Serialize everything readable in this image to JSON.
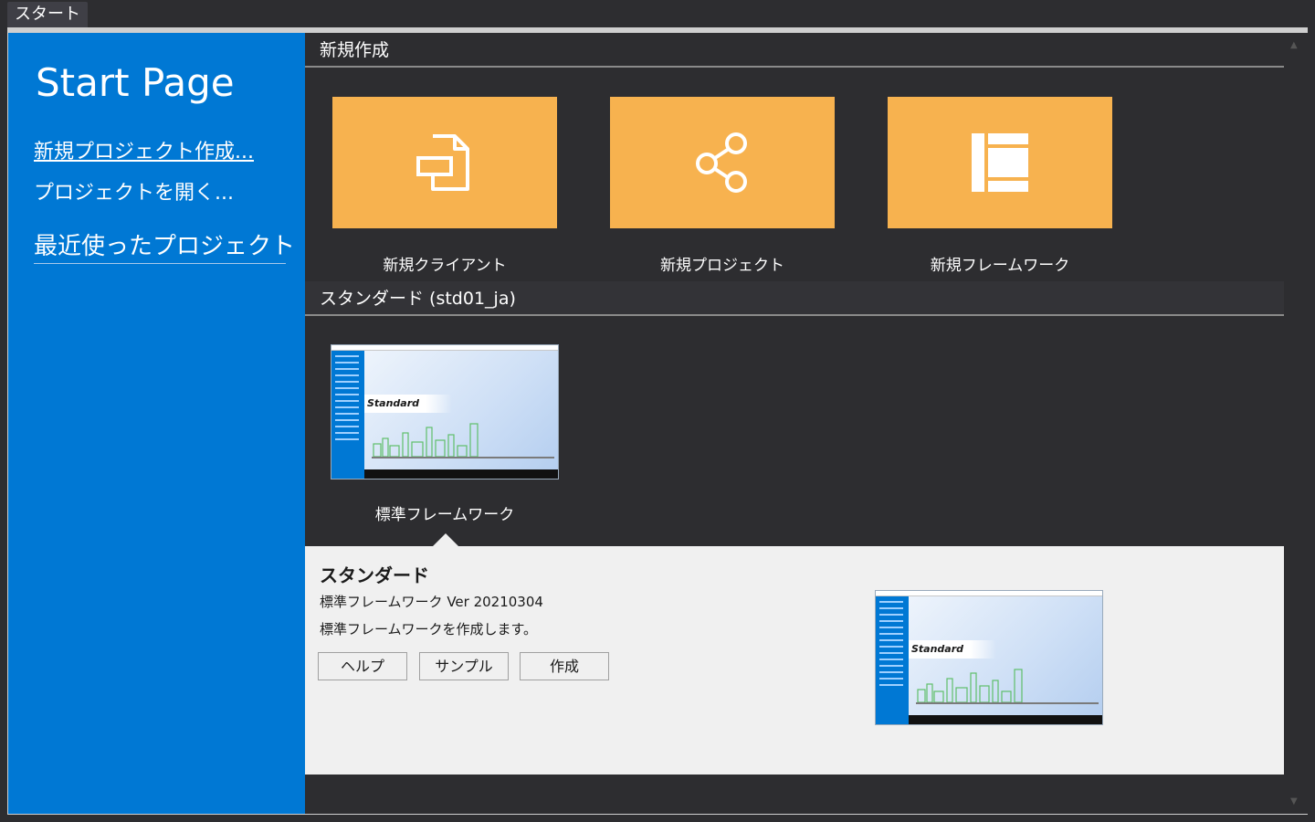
{
  "window": {
    "doc_tab": "スタート"
  },
  "sidebar": {
    "title": "Start Page",
    "new_project_link": "新規プロジェクト作成...",
    "open_project_link": "プロジェクトを開く...",
    "recent_header": "最近使ったプロジェクト"
  },
  "sections": {
    "new": {
      "header": "新規作成",
      "tiles": [
        {
          "label": "新規クライアント",
          "icon": "new-client-icon"
        },
        {
          "label": "新規プロジェクト",
          "icon": "share-nodes-icon"
        },
        {
          "label": "新規フレームワーク",
          "icon": "framework-layout-icon"
        }
      ]
    },
    "standard": {
      "header": "スタンダード (std01_ja)",
      "templates": [
        {
          "label": "標準フレームワーク",
          "thumbnail_badge": "Standard"
        }
      ]
    }
  },
  "details": {
    "title": "スタンダード",
    "version": "標準フレームワーク Ver 20210304",
    "description": "標準フレームワークを作成します。",
    "buttons": {
      "help": "ヘルプ",
      "sample": "サンプル",
      "create": "作成"
    },
    "thumbnail_badge": "Standard"
  },
  "colors": {
    "sidebar": "#0078d4",
    "tile": "#f7b24f",
    "background": "#2d2d30",
    "details_panel": "#f0f0f0"
  }
}
